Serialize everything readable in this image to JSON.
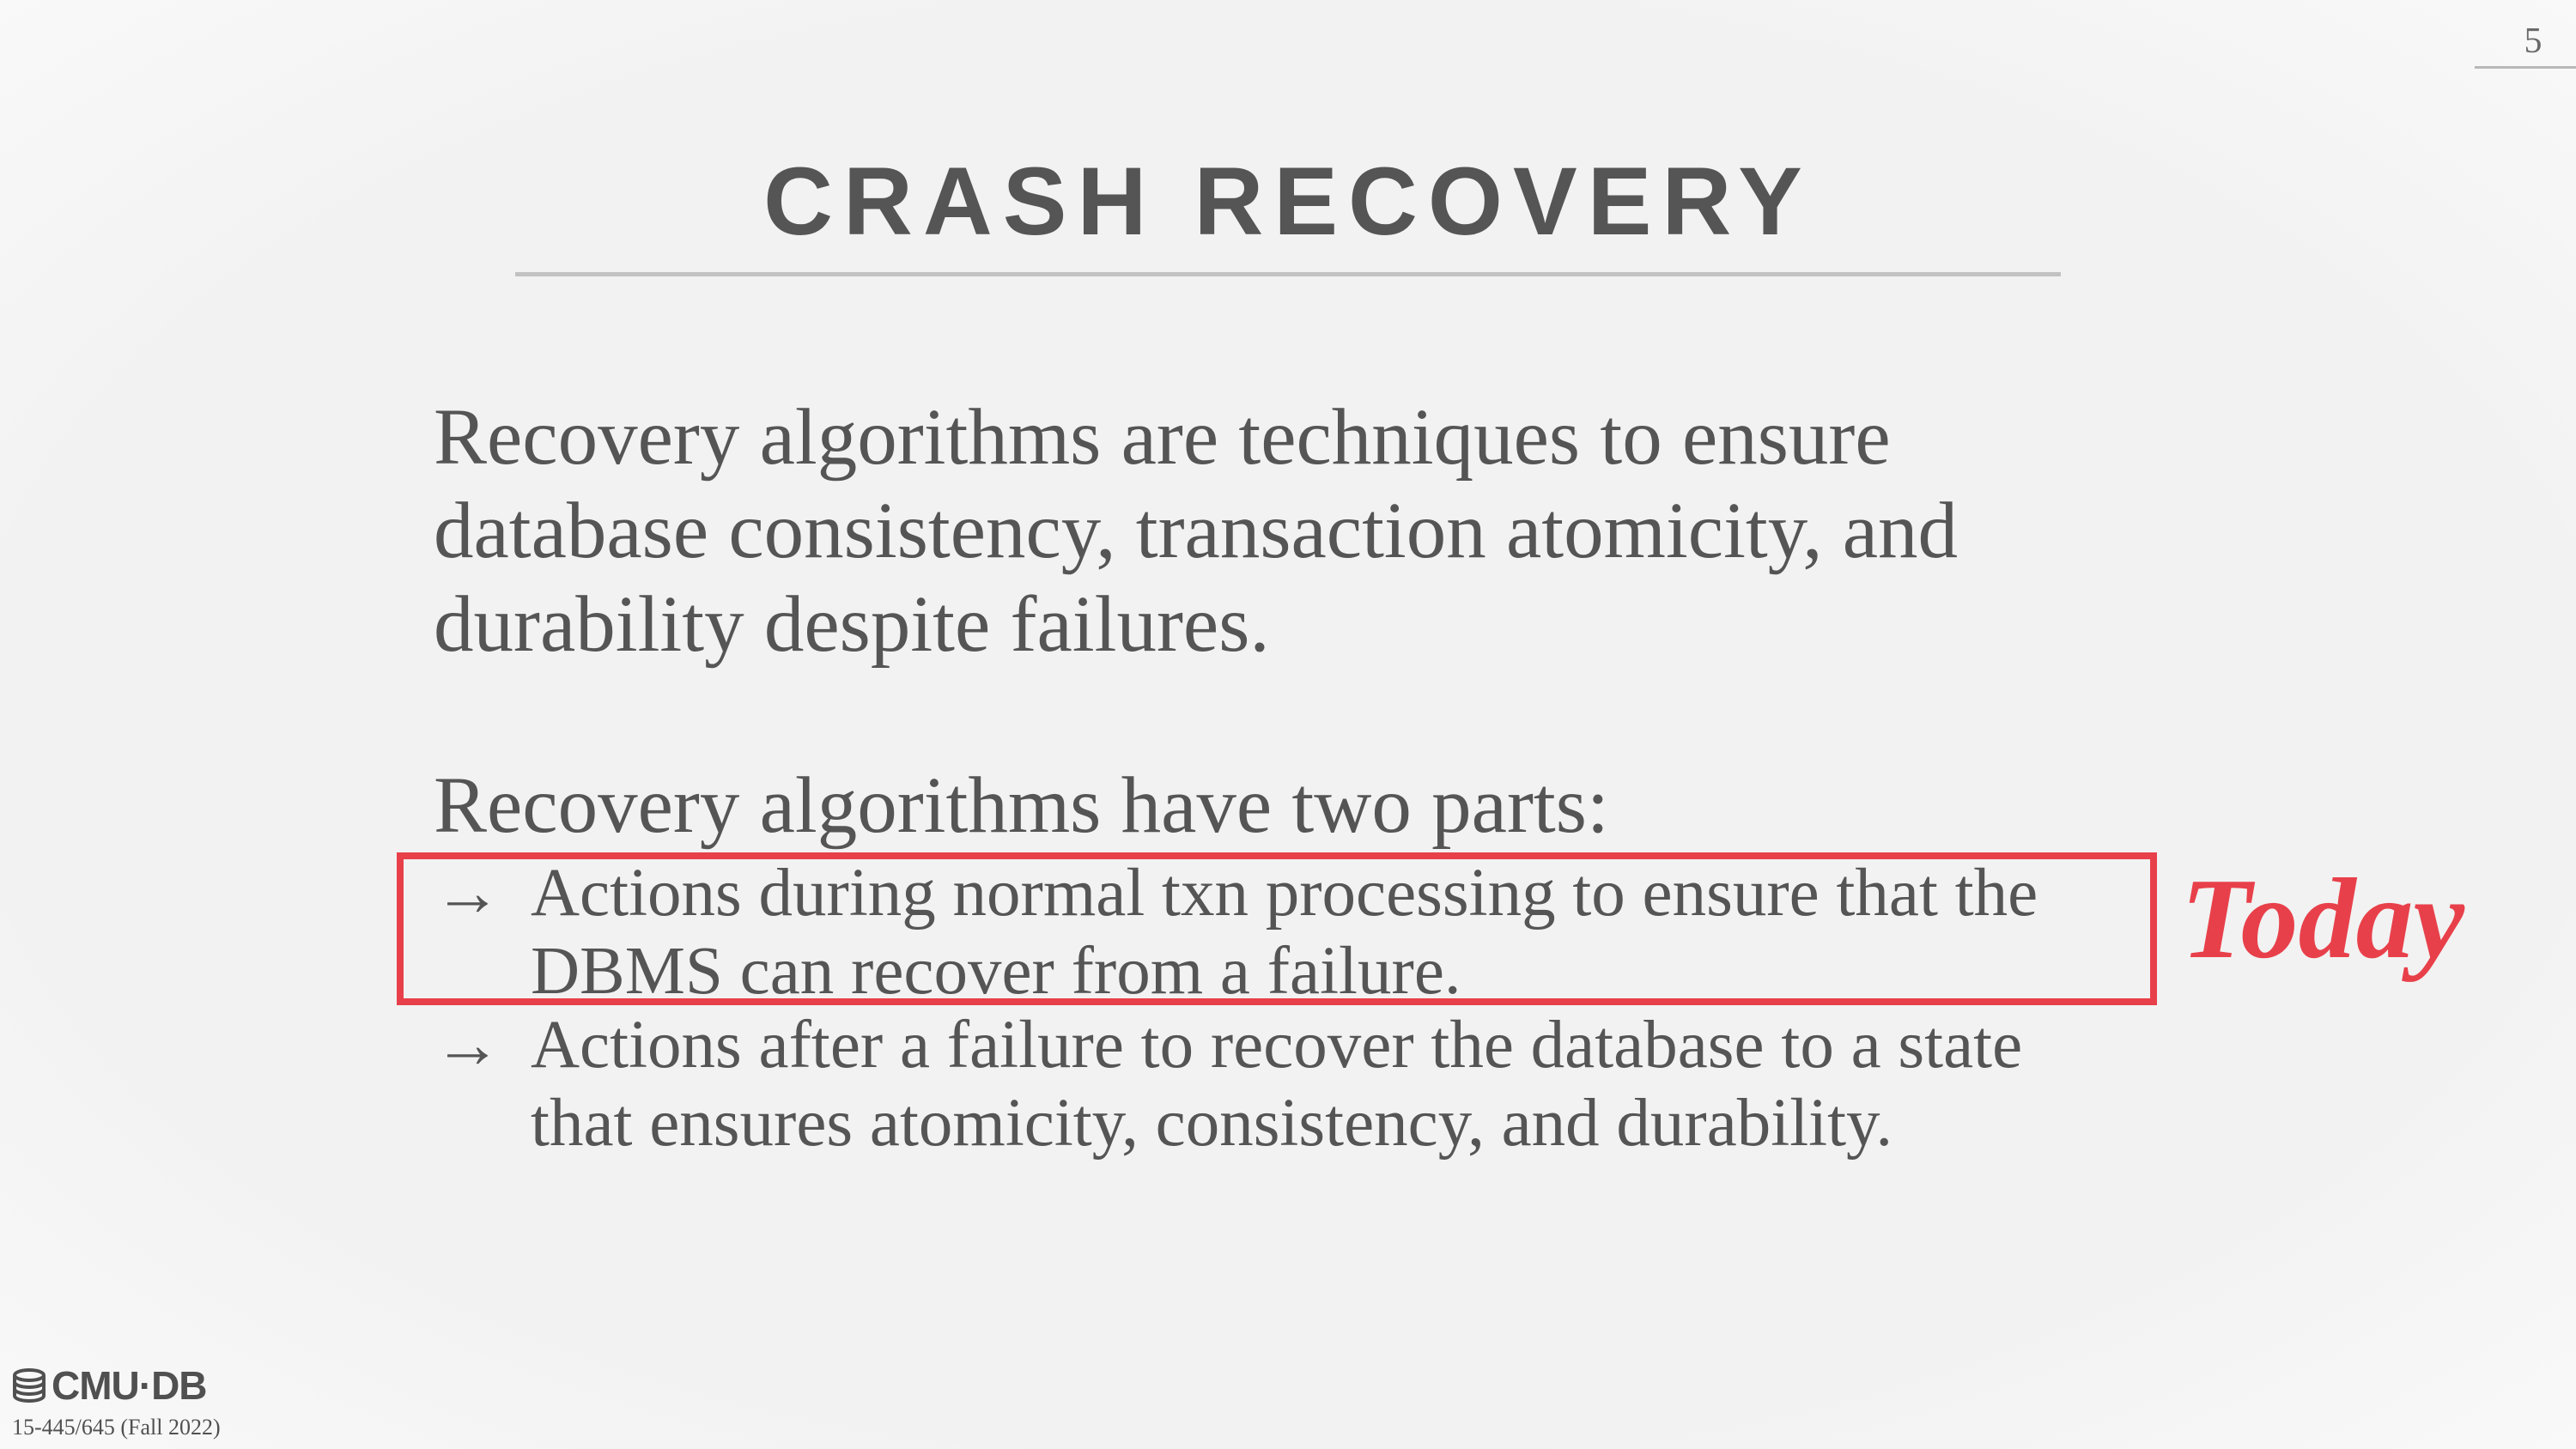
{
  "page_number": "5",
  "title": "CRASH RECOVERY",
  "paragraphs": [
    "Recovery algorithms are techniques to ensure database consistency, transaction atomicity, and durability despite failures.",
    "Recovery algorithms have two parts:"
  ],
  "bullets": [
    {
      "arrow": "→",
      "text_line1": "Actions during normal txn processing to ensure that the",
      "text_line2": "DBMS can recover from a failure."
    },
    {
      "arrow": "→",
      "text_line1": "Actions after a failure to recover the database to a state",
      "text_line2": "that ensures atomicity, consistency, and durability."
    }
  ],
  "annotation": "Today",
  "footer": {
    "logo_text": "CMU·DB",
    "course": "15-445/645 (Fall 2022)"
  },
  "colors": {
    "accent_red": "#e8404a",
    "text": "#555555",
    "rule": "#c2c2c2"
  },
  "icons": {
    "logo": "database-stack-icon"
  }
}
